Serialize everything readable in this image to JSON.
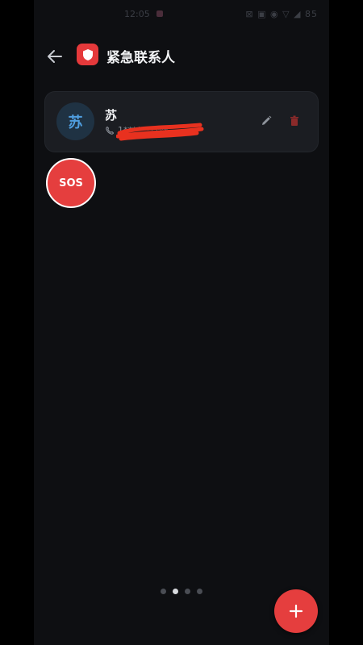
{
  "status_bar": {
    "time": "12:05",
    "icons_text": "⊠ ▣ ◉ ▽ ◢ 85"
  },
  "header": {
    "title": "紧急联系人"
  },
  "contacts": [
    {
      "avatar_initial": "苏",
      "name": "苏",
      "phone": "1**********"
    }
  ],
  "sos": {
    "label": "SOS"
  },
  "pager": {
    "count": 4,
    "active_index": 1
  },
  "colors": {
    "background": "#0e0f12",
    "card": "#1b1d22",
    "accent_red": "#e53e3e",
    "avatar_bg": "#1f3243",
    "avatar_text": "#4f9ee0"
  },
  "icons": {
    "back": "arrow-left-icon",
    "app": "shield-icon",
    "phone": "phone-icon",
    "edit": "pencil-icon",
    "delete": "trash-icon",
    "add": "plus-icon"
  }
}
